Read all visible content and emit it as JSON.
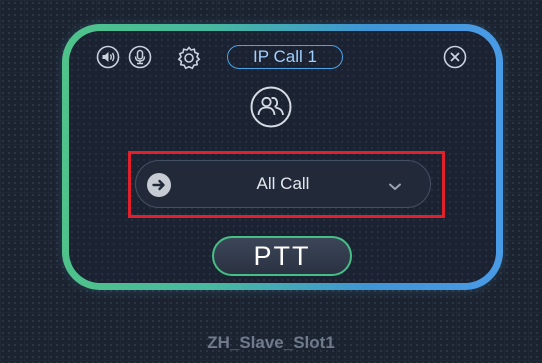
{
  "panel": {
    "title": "IP Call 1",
    "icons": [
      "speaker-icon",
      "microphone-icon",
      "gear-icon",
      "close-icon",
      "group-icon"
    ]
  },
  "call_target": {
    "selected": "All Call",
    "icons": [
      "arrow-right-icon",
      "chevron-down-icon"
    ]
  },
  "ptt": {
    "label": "PTT"
  },
  "slot": {
    "label": "ZH_Slave_Slot1"
  },
  "colors": {
    "background": "#1c2330",
    "frame_green": "#4fc38a",
    "frame_blue": "#4a9be6",
    "title_accent": "#4aa3e6",
    "highlight_red": "#e0202a",
    "ptt_border": "#46bf86"
  }
}
